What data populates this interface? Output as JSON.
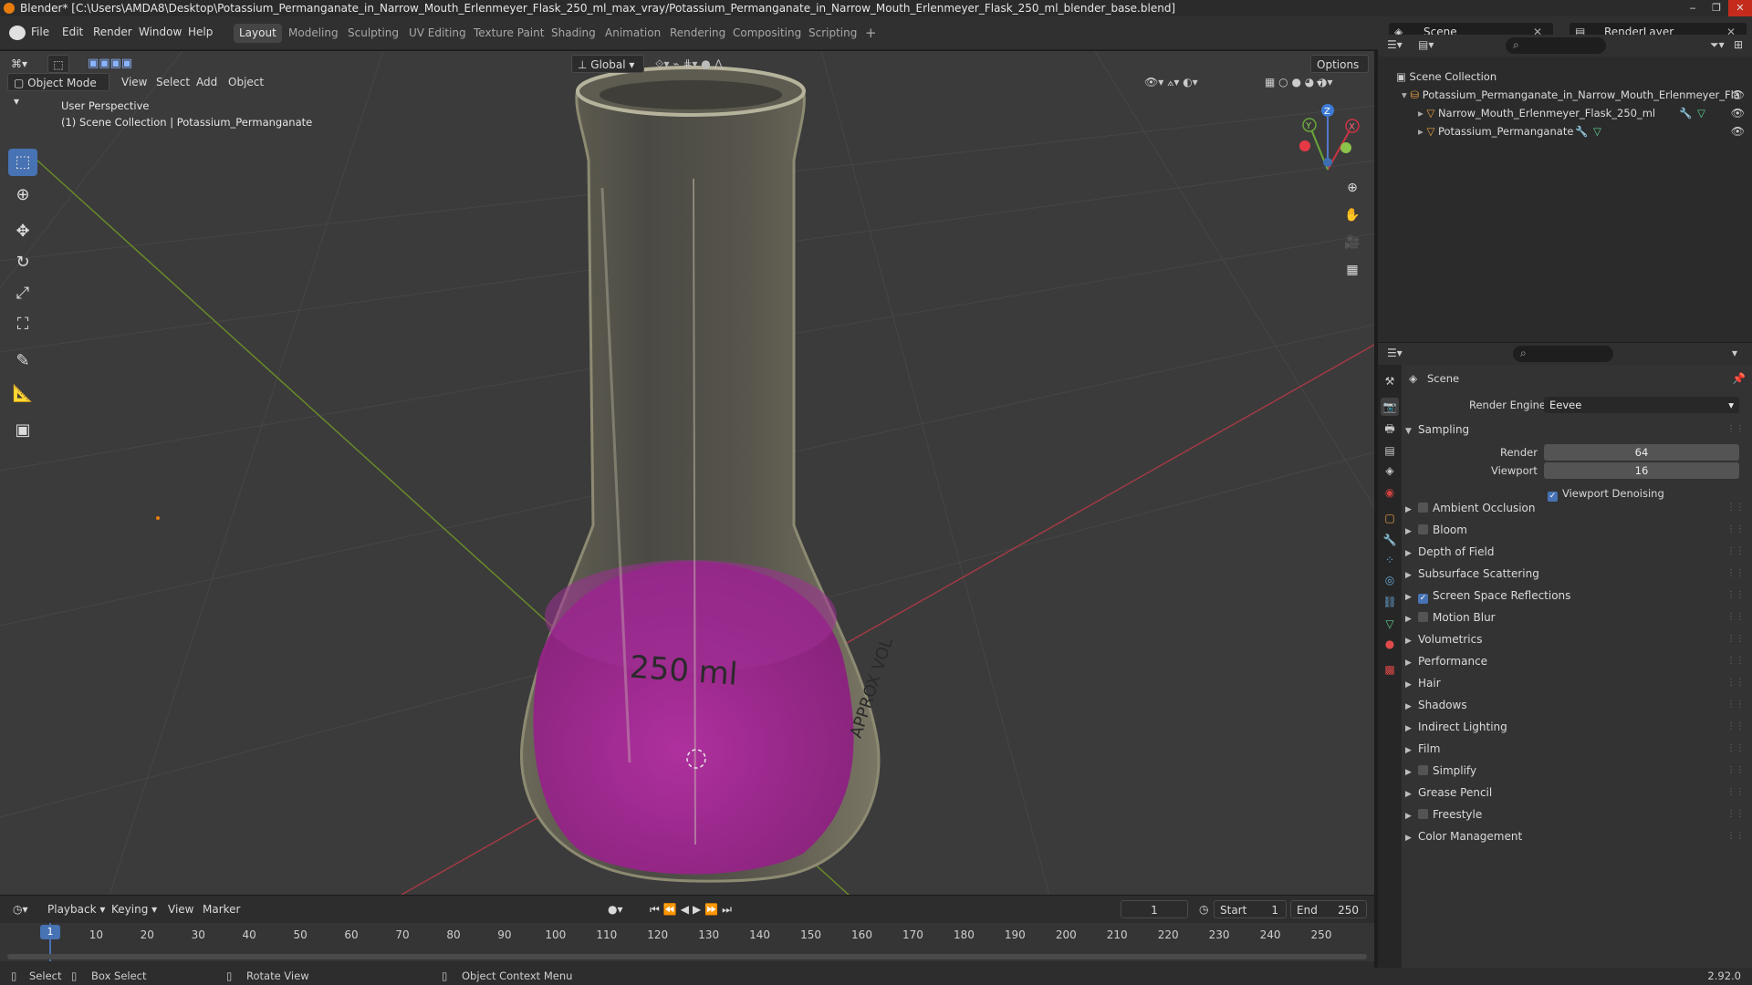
{
  "window": {
    "title": "Blender* [C:\\Users\\AMDA8\\Desktop\\Potassium_Permanganate_in_Narrow_Mouth_Erlenmeyer_Flask_250_ml_max_vray/Potassium_Permanganate_in_Narrow_Mouth_Erlenmeyer_Flask_250_ml_blender_base.blend]",
    "controls": [
      "‒",
      "❐",
      "✕"
    ]
  },
  "menubar": {
    "items": [
      "File",
      "Edit",
      "Render",
      "Window",
      "Help"
    ],
    "workspaces": [
      "Layout",
      "Modeling",
      "Sculpting",
      "UV Editing",
      "Texture Paint",
      "Shading",
      "Animation",
      "Rendering",
      "Compositing",
      "Scripting"
    ],
    "active_workspace": "Layout",
    "add_tab": "+",
    "scene_label": "Scene",
    "view_layer": "RenderLayer"
  },
  "viewport": {
    "mode": "Object Mode",
    "menus": [
      "View",
      "Select",
      "Add",
      "Object"
    ],
    "transform_orientation": "Global",
    "options_label": "Options",
    "perspective": "User Perspective",
    "collection_info": "(1) Scene Collection | Potassium_Permanganate",
    "flask_label": "250 ml",
    "flask_side_label": "APPROX VOL",
    "gizmo": {
      "x": "X",
      "y": "Y",
      "z": "Z"
    }
  },
  "tools": [
    "select-box",
    "cursor",
    "move",
    "rotate",
    "scale",
    "transform",
    "annotate",
    "measure",
    "add-cube"
  ],
  "outliner": {
    "root": "Scene Collection",
    "collection": "Potassium_Permanganate_in_Narrow_Mouth_Erlenmeyer_Fla",
    "objects": [
      "Narrow_Mouth_Erlenmeyer_Flask_250_ml",
      "Potassium_Permanganate"
    ]
  },
  "properties": {
    "context": "Scene",
    "render_engine_label": "Render Engine",
    "render_engine": "Eevee",
    "sampling": {
      "title": "Sampling",
      "render_label": "Render",
      "render": "64",
      "viewport_label": "Viewport",
      "viewport": "16",
      "denoise": "Viewport Denoising",
      "denoise_on": true
    },
    "sections": [
      {
        "label": "Ambient Occlusion",
        "checkbox": true,
        "checked": false
      },
      {
        "label": "Bloom",
        "checkbox": true,
        "checked": false
      },
      {
        "label": "Depth of Field",
        "checkbox": false
      },
      {
        "label": "Subsurface Scattering",
        "checkbox": false
      },
      {
        "label": "Screen Space Reflections",
        "checkbox": true,
        "checked": true
      },
      {
        "label": "Motion Blur",
        "checkbox": true,
        "checked": false
      },
      {
        "label": "Volumetrics",
        "checkbox": false
      },
      {
        "label": "Performance",
        "checkbox": false
      },
      {
        "label": "Hair",
        "checkbox": false
      },
      {
        "label": "Shadows",
        "checkbox": false
      },
      {
        "label": "Indirect Lighting",
        "checkbox": false
      },
      {
        "label": "Film",
        "checkbox": false
      },
      {
        "label": "Simplify",
        "checkbox": true,
        "checked": false
      },
      {
        "label": "Grease Pencil",
        "checkbox": false
      },
      {
        "label": "Freestyle",
        "checkbox": true,
        "checked": false
      },
      {
        "label": "Color Management",
        "checkbox": false
      }
    ]
  },
  "timeline": {
    "menus": [
      "Playback",
      "Keying",
      "View",
      "Marker"
    ],
    "current_frame": "1",
    "start_label": "Start",
    "start": "1",
    "end_label": "End",
    "end": "250",
    "ticks": [
      "1",
      "10",
      "20",
      "30",
      "40",
      "50",
      "60",
      "70",
      "80",
      "90",
      "100",
      "110",
      "120",
      "130",
      "140",
      "150",
      "160",
      "170",
      "180",
      "190",
      "200",
      "210",
      "220",
      "230",
      "240",
      "250"
    ]
  },
  "statusbar": {
    "items": [
      "Select",
      "Box Select",
      "Rotate View",
      "Object Context Menu"
    ],
    "version": "2.92.0"
  },
  "colors": {
    "accent": "#4772b3",
    "liquid": "#b0279e",
    "orange": "#e87d0d"
  }
}
